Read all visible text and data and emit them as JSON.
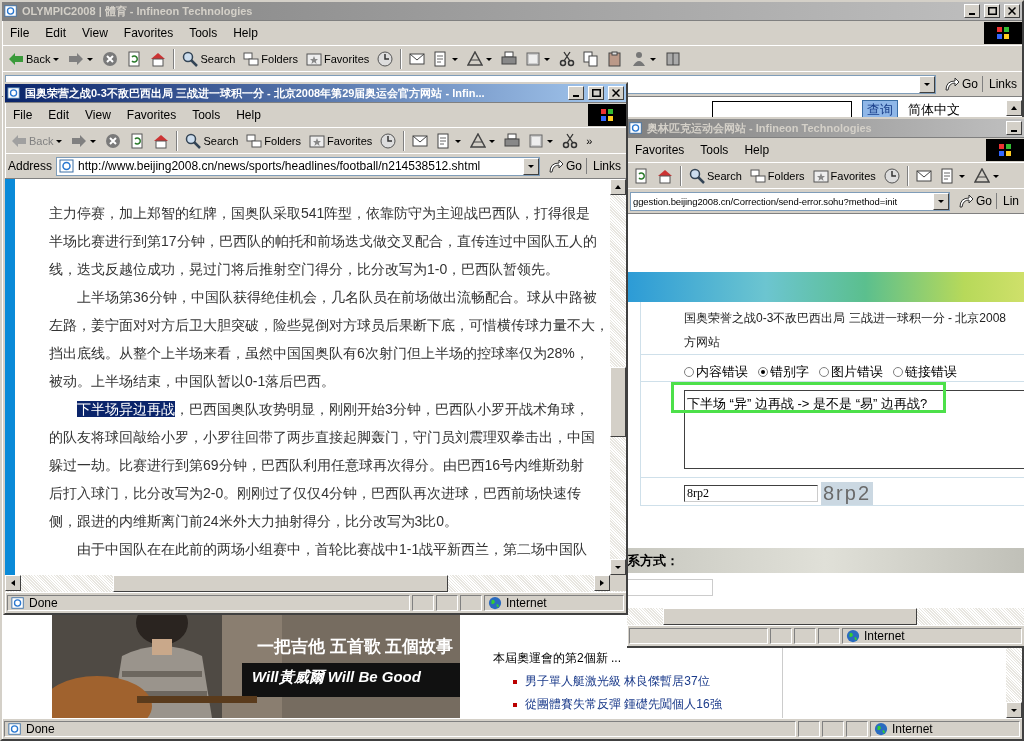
{
  "back_window": {
    "title": "OLYMPIC2008 | 體育 - Infineon Technologies",
    "menu": [
      "File",
      "Edit",
      "View",
      "Favorites",
      "Tools",
      "Help"
    ],
    "back_button": {
      "label": "Back",
      "disabled": false
    },
    "toolbar": [
      {
        "kind": "forward"
      },
      {
        "kind": "stop"
      },
      {
        "kind": "refresh"
      },
      {
        "kind": "home"
      },
      {
        "kind": "search",
        "label": "Search"
      },
      {
        "kind": "folders",
        "label": "Folders"
      },
      {
        "kind": "favorites",
        "label": "Favorites"
      },
      {
        "kind": "history"
      },
      {
        "kind": "mail"
      },
      {
        "kind": "edit"
      },
      {
        "kind": "discuss"
      },
      {
        "kind": "print"
      },
      {
        "kind": "word"
      },
      {
        "kind": "cut"
      },
      {
        "kind": "copy"
      },
      {
        "kind": "paste"
      },
      {
        "kind": "messenger"
      },
      {
        "kind": "research"
      }
    ],
    "go": "Go",
    "links": "Links",
    "search_button": "查询",
    "language": "简体中文",
    "ad": {
      "line_1": "一把吉他  五首歌  五個故事",
      "line_2": "Will黃威爾  Will Be Good"
    },
    "news_intro": "本屆奧運會的第2個新 ...",
    "news_items": [
      "男子單人艇激光級 林良傑暫居37位",
      "從團體賽失常反彈 鍾礎先闖個人16強"
    ],
    "status": "Done",
    "zone": "Internet"
  },
  "middle_window": {
    "title": "奥林匹克运动会网站 - Infineon Technologies",
    "menu": [
      "Favorites",
      "Tools",
      "Help"
    ],
    "toolbar": [
      {
        "kind": "refresh"
      },
      {
        "kind": "home"
      },
      {
        "kind": "search",
        "label": "Search"
      },
      {
        "kind": "folders",
        "label": "Folders"
      },
      {
        "kind": "favorites",
        "label": "Favorites"
      },
      {
        "kind": "history"
      },
      {
        "kind": "mail"
      },
      {
        "kind": "edit"
      },
      {
        "kind": "discuss"
      }
    ],
    "address": "ggestion.beijing2008.cn/Correction/send-error.sohu?method=init",
    "go": "Go",
    "links": "Lin",
    "page_title_lines": [
      "国奥荣誉之战0-3不敌巴西出局 三战进一球积一分 - 北京2008",
      "方网站"
    ],
    "error_types": [
      {
        "label": "内容错误",
        "selected": false
      },
      {
        "label": "错别字",
        "selected": true
      },
      {
        "label": "图片错误",
        "selected": false
      },
      {
        "label": "链接错误",
        "selected": false
      }
    ],
    "comment": {
      "value": "下半场 “异” 边再战 -> 是不是 “易” 边再战?",
      "highlighted": true
    },
    "captcha_value": "8rp2",
    "captcha_image": "8rp2",
    "section_heading": "系方式：",
    "zone": "Internet"
  },
  "front_window": {
    "title": "国奥荣营之战0-3不敌巴西出局 三战进一球积一分 - 北京2008年第29届奥运会官方网站 - Infin...",
    "menu": [
      "File",
      "Edit",
      "View",
      "Favorites",
      "Tools",
      "Help"
    ],
    "back_button": {
      "label": "Back",
      "disabled": true
    },
    "toolbar": [
      {
        "kind": "forward"
      },
      {
        "kind": "stop"
      },
      {
        "kind": "refresh"
      },
      {
        "kind": "home"
      },
      {
        "kind": "search",
        "label": "Search"
      },
      {
        "kind": "folders",
        "label": "Folders"
      },
      {
        "kind": "favorites",
        "label": "Favorites"
      },
      {
        "kind": "history"
      },
      {
        "kind": "mail"
      },
      {
        "kind": "edit"
      },
      {
        "kind": "discuss"
      },
      {
        "kind": "print"
      },
      {
        "kind": "word"
      },
      {
        "kind": "cut"
      },
      {
        "kind": "more",
        "label": "»"
      }
    ],
    "address_label": "Address",
    "address": "http://www.beijing2008.cn/news/sports/headlines/football/n214538512.shtml",
    "go": "Go",
    "links": "Links",
    "paragraphs": [
      {
        "continued": true,
        "lines": [
          "主力停赛，加上郑智的红牌，国奥队采取541阵型，依靠防守为主迎战巴西队，打得很是",
          "半场比赛进行到第17分钟，巴西队的帕托和前场迭戈做交叉配合，直传连过中国队五人的",
          "线，迭戈反越位成功，晃过门将后推射空门得分，比分改写为1-0，巴西队暂领先。"
        ]
      },
      {
        "continued": false,
        "lines": [
          "上半场第36分钟，中国队获得绝佳机会，几名队员在前场做出流畅配合。球从中路被",
          "左路，姜宁面对对方后卫大胆突破，险些晃倒对方球员后果断下底，可惜横传球力量不大，",
          "挡出底线。从整个上半场来看，虽然中国国奥队有6次射门但上半场的控球率仅为28%，",
          "被动。上半场结束，中国队暂以0-1落后巴西。"
        ]
      },
      {
        "continued": false,
        "selection": "下半场异边再战",
        "lines": [
          "，巴西国奥队攻势明显，刚刚开始3分钟，巴西队小罗开战术角球，",
          "的队友将球回敲给小罗，小罗往回带了两步直接起脚轰门，守门员刘震理双拳击出，中国",
          "躲过一劫。比赛进行到第69分钟，巴西队利用任意球再次得分。由巴西16号内维斯劲射",
          "后打入球门，比分改写为2-0。刚刚过了仅仅4分钟，巴西队再次进球，巴西前场快速传",
          "侧，跟进的内维斯离门前24米外大力抽射得分，比分改写为3比0。"
        ]
      },
      {
        "continued": false,
        "lines": [
          "由于中国队在在此前的两场小组赛中，首轮比赛战中1-1战平新西兰，第二场中国队"
        ]
      }
    ],
    "status": "Done",
    "zone": "Internet"
  }
}
